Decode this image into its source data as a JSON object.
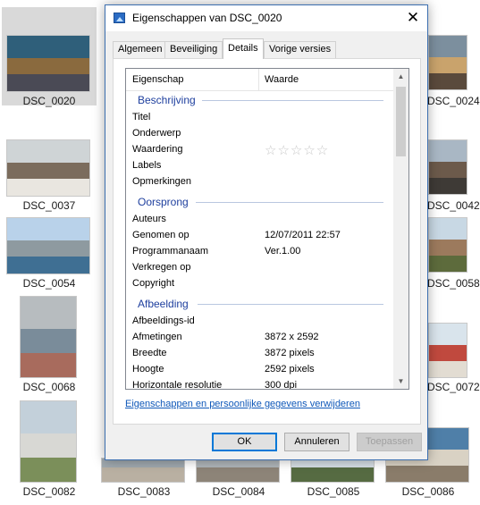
{
  "explorer": {
    "tiles": [
      {
        "label": "DSC_0020"
      },
      {
        "label": "DSC_0024"
      },
      {
        "label": "DSC_0037"
      },
      {
        "label": "DSC_0042"
      },
      {
        "label": "DSC_0054"
      },
      {
        "label": "DSC_0058"
      },
      {
        "label": "DSC_0068"
      },
      {
        "label": "DSC_0072"
      },
      {
        "label": "DSC_0082"
      },
      {
        "label": "DSC_0083"
      },
      {
        "label": "DSC_0084"
      },
      {
        "label": "DSC_0085"
      },
      {
        "label": "DSC_0086"
      }
    ]
  },
  "dialog": {
    "title": "Eigenschappen van DSC_0020",
    "close_glyph": "✕",
    "tabs": [
      "Algemeen",
      "Beveiliging",
      "Details",
      "Vorige versies"
    ],
    "active_tab": "Details",
    "columns": {
      "property": "Eigenschap",
      "value": "Waarde"
    },
    "groups": {
      "description": "Beschrijving",
      "origin": "Oorsprong",
      "image": "Afbeelding"
    },
    "rows": {
      "title": {
        "key": "Titel",
        "value": ""
      },
      "subject": {
        "key": "Onderwerp",
        "value": ""
      },
      "rating": {
        "key": "Waardering",
        "stars": "☆☆☆☆☆",
        "rating_value": 0
      },
      "labels": {
        "key": "Labels",
        "value": ""
      },
      "comments": {
        "key": "Opmerkingen",
        "value": ""
      },
      "authors": {
        "key": "Auteurs",
        "value": ""
      },
      "date_taken": {
        "key": "Genomen op",
        "value": "12/07/2011 22:57"
      },
      "program": {
        "key": "Programmanaam",
        "value": "Ver.1.00"
      },
      "acquired": {
        "key": "Verkregen op",
        "value": ""
      },
      "copyright": {
        "key": "Copyright",
        "value": ""
      },
      "image_id": {
        "key": "Afbeeldings-id",
        "value": ""
      },
      "dimensions": {
        "key": "Afmetingen",
        "value": "3872 x 2592"
      },
      "width": {
        "key": "Breedte",
        "value": "3872 pixels"
      },
      "height": {
        "key": "Hoogte",
        "value": "2592 pixels"
      },
      "h_resolution": {
        "key": "Horizontale resolutie",
        "value": "300 dpi"
      }
    },
    "remove_link": "Eigenschappen en persoonlijke gegevens verwijderen",
    "buttons": {
      "ok": "OK",
      "cancel": "Annuleren",
      "apply": "Toepassen"
    }
  }
}
